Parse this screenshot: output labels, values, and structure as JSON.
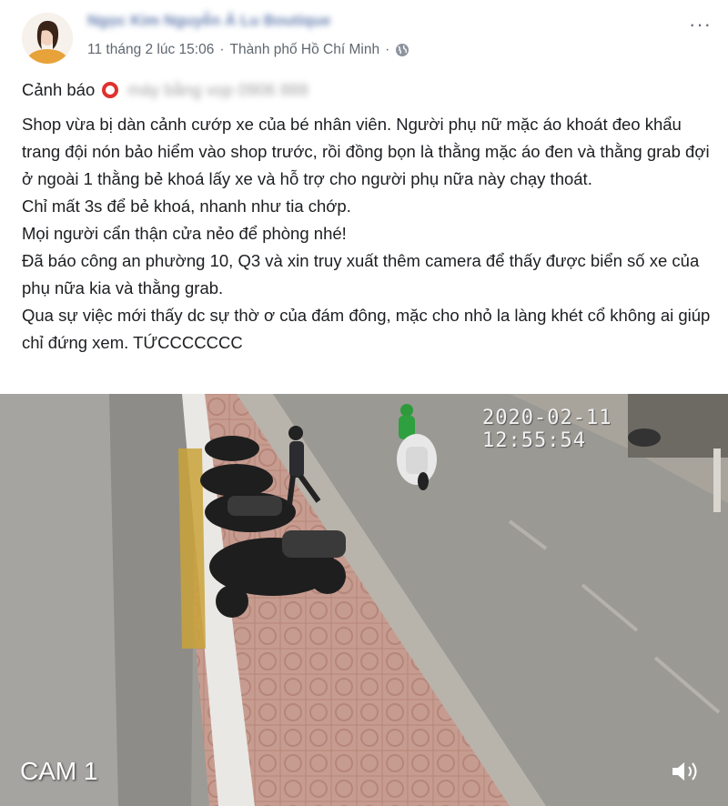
{
  "post": {
    "author_name": "Ngọc Kim Nguyễn Ả Lu Boutique",
    "timestamp": "11 tháng 2 lúc 15:06",
    "separator": "·",
    "location": "Thành phố Hồ Chí Minh",
    "more_label": "···",
    "warning_prefix": "Cảnh báo",
    "warning_blurred": "máy bằng vọp 0906 888",
    "paragraphs": [
      "Shop vừa bị dàn cảnh cướp xe của bé nhân viên. Người phụ nữ mặc áo khoát đeo khẩu trang đội nón bảo hiểm vào shop trước, rồi đồng bọn là thằng mặc áo đen và thằng grab đợi ở ngoài 1 thằng bẻ khoá lấy xe và hỗ trợ cho người phụ nữa này chạy thoát.",
      "Chỉ mất 3s để bẻ khoá, nhanh như tia chớp.",
      "Mọi người cẩn thận cửa nẻo để phòng nhé!",
      "Đã báo công an phường 10, Q3 và xin truy xuất thêm camera để thấy được biển số xe của phụ nữa kia và thằng grab.",
      "Qua sự việc mới thấy dc sự thờ ơ của đám đông, mặc cho nhỏ la làng khét cổ không ai giúp chỉ đứng xem. TỨCCCCCCC"
    ]
  },
  "video": {
    "timestamp_overlay": "2020-02-11 12:55:54",
    "camera_label": "CAM 1"
  },
  "icons": {
    "globe": "globe-icon",
    "volume": "volume-icon",
    "more": "more-options-icon"
  },
  "colors": {
    "link": "#385898",
    "meta": "#606770",
    "warning": "#e0312e"
  }
}
